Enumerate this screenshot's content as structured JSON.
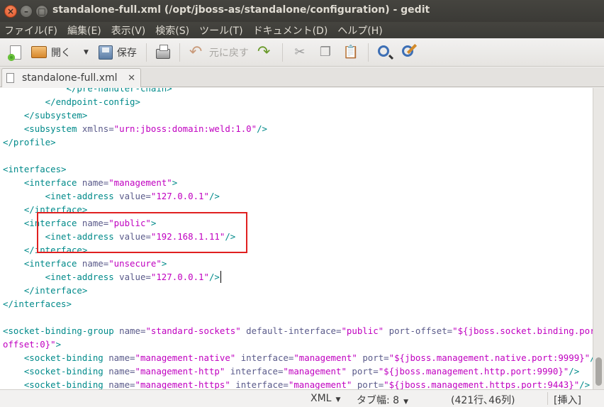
{
  "window": {
    "title": "standalone-full.xml (/opt/jboss-as/standalone/configuration) - gedit",
    "close_glyph": "×",
    "minimize_glyph": "–",
    "maximize_glyph": "□"
  },
  "menubar": {
    "items": [
      "ファイル(F)",
      "編集(E)",
      "表示(V)",
      "検索(S)",
      "ツール(T)",
      "ドキュメント(D)",
      "ヘルプ(H)"
    ]
  },
  "toolbar": {
    "open_label": "開く",
    "save_label": "保存",
    "undo_label": "元に戻す",
    "icons": [
      "new-document-icon",
      "open-folder-icon",
      "save-icon",
      "print-icon",
      "undo-icon",
      "redo-icon",
      "cut-icon",
      "copy-icon",
      "paste-icon",
      "find-icon",
      "find-replace-icon"
    ]
  },
  "tab": {
    "label": "standalone-full.xml",
    "close_glyph": "✕"
  },
  "editor": {
    "lines": [
      [
        {
          "t": "            </pre-handler-chain>",
          "c": "tag"
        }
      ],
      [
        {
          "t": "        </endpoint-config>",
          "c": "tag"
        }
      ],
      [
        {
          "t": "    </subsystem>",
          "c": "tag"
        }
      ],
      [
        {
          "t": "    <subsystem ",
          "c": "tag"
        },
        {
          "t": "xmlns=",
          "c": "attr"
        },
        {
          "t": "\"urn:jboss:domain:weld:1.0\"",
          "c": "val"
        },
        {
          "t": "/>",
          "c": "tag"
        }
      ],
      [
        {
          "t": "</profile>",
          "c": "tag"
        }
      ],
      [],
      [
        {
          "t": "<interfaces>",
          "c": "tag"
        }
      ],
      [
        {
          "t": "    <interface ",
          "c": "tag"
        },
        {
          "t": "name=",
          "c": "attr"
        },
        {
          "t": "\"management\"",
          "c": "val"
        },
        {
          "t": ">",
          "c": "tag"
        }
      ],
      [
        {
          "t": "        <inet-address ",
          "c": "tag"
        },
        {
          "t": "value=",
          "c": "attr"
        },
        {
          "t": "\"127.0.0.1\"",
          "c": "val"
        },
        {
          "t": "/>",
          "c": "tag"
        }
      ],
      [
        {
          "t": "    </interface>",
          "c": "tag"
        }
      ],
      [
        {
          "t": "    <interface ",
          "c": "tag"
        },
        {
          "t": "name=",
          "c": "attr"
        },
        {
          "t": "\"public\"",
          "c": "val"
        },
        {
          "t": ">",
          "c": "tag"
        }
      ],
      [
        {
          "t": "        <inet-address ",
          "c": "tag"
        },
        {
          "t": "value=",
          "c": "attr"
        },
        {
          "t": "\"192.168.1.11\"",
          "c": "val"
        },
        {
          "t": "/>",
          "c": "tag"
        }
      ],
      [
        {
          "t": "    </interface>",
          "c": "tag"
        }
      ],
      [
        {
          "t": "    <interface ",
          "c": "tag"
        },
        {
          "t": "name=",
          "c": "attr"
        },
        {
          "t": "\"unsecure\"",
          "c": "val"
        },
        {
          "t": ">",
          "c": "tag"
        }
      ],
      [
        {
          "t": "        <inet-address ",
          "c": "tag"
        },
        {
          "t": "value=",
          "c": "attr"
        },
        {
          "t": "\"127.0.0.1\"",
          "c": "val"
        },
        {
          "t": "/>",
          "c": "tag"
        }
      ],
      [
        {
          "t": "    </interface>",
          "c": "tag"
        }
      ],
      [
        {
          "t": "</interfaces>",
          "c": "tag"
        }
      ],
      [],
      [
        {
          "t": "<socket-binding-group ",
          "c": "tag"
        },
        {
          "t": "name=",
          "c": "attr"
        },
        {
          "t": "\"standard-sockets\"",
          "c": "val"
        },
        {
          "t": " default-interface=",
          "c": "attr"
        },
        {
          "t": "\"public\"",
          "c": "val"
        },
        {
          "t": " port-offset=",
          "c": "attr"
        },
        {
          "t": "\"${jboss.socket.binding.port-",
          "c": "val"
        }
      ],
      [
        {
          "t": "offset:0}\"",
          "c": "val"
        },
        {
          "t": ">",
          "c": "tag"
        }
      ],
      [
        {
          "t": "    <socket-binding ",
          "c": "tag"
        },
        {
          "t": "name=",
          "c": "attr"
        },
        {
          "t": "\"management-native\"",
          "c": "val"
        },
        {
          "t": " interface=",
          "c": "attr"
        },
        {
          "t": "\"management\"",
          "c": "val"
        },
        {
          "t": " port=",
          "c": "attr"
        },
        {
          "t": "\"${jboss.management.native.port:9999}\"",
          "c": "val"
        },
        {
          "t": "/>",
          "c": "tag"
        }
      ],
      [
        {
          "t": "    <socket-binding ",
          "c": "tag"
        },
        {
          "t": "name=",
          "c": "attr"
        },
        {
          "t": "\"management-http\"",
          "c": "val"
        },
        {
          "t": " interface=",
          "c": "attr"
        },
        {
          "t": "\"management\"",
          "c": "val"
        },
        {
          "t": " port=",
          "c": "attr"
        },
        {
          "t": "\"${jboss.management.http.port:9990}\"",
          "c": "val"
        },
        {
          "t": "/>",
          "c": "tag"
        }
      ],
      [
        {
          "t": "    <socket-binding ",
          "c": "tag"
        },
        {
          "t": "name=",
          "c": "attr"
        },
        {
          "t": "\"management-https\"",
          "c": "val"
        },
        {
          "t": " interface=",
          "c": "attr"
        },
        {
          "t": "\"management\"",
          "c": "val"
        },
        {
          "t": " port=",
          "c": "attr"
        },
        {
          "t": "\"${jboss.management.https.port:9443}\"",
          "c": "val"
        },
        {
          "t": "/>",
          "c": "tag"
        }
      ]
    ]
  },
  "statusbar": {
    "language": "XML",
    "tab_width": "タブ幅: 8",
    "position": "(421行､46列)",
    "mode": "[挿入]"
  },
  "colors": {
    "tag": "#008a8a",
    "attribute": "#5a5a8a",
    "value": "#c000c0",
    "highlight_box": "#e02020"
  }
}
